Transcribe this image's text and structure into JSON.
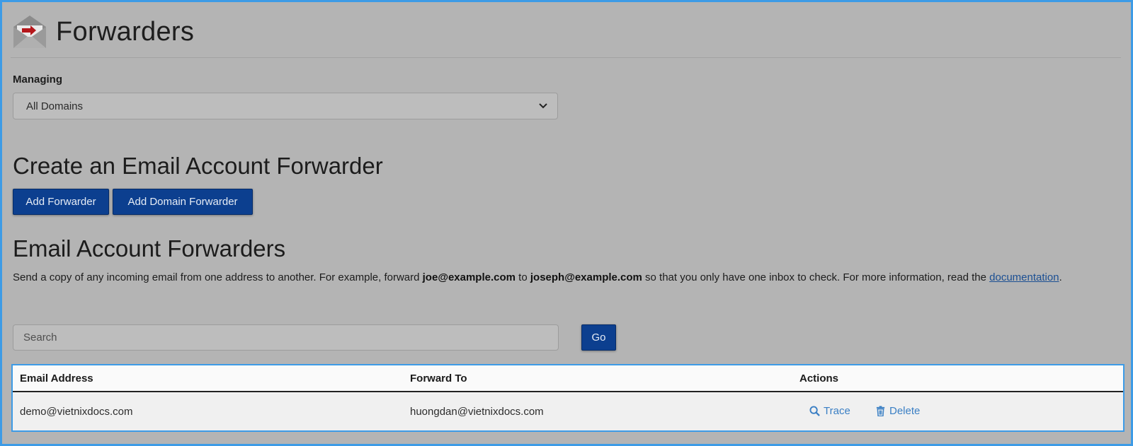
{
  "header": {
    "title": "Forwarders"
  },
  "managing": {
    "label": "Managing",
    "selected": "All Domains"
  },
  "create": {
    "heading": "Create an Email Account Forwarder",
    "add_forwarder": "Add Forwarder",
    "add_domain_forwarder": "Add Domain Forwarder"
  },
  "list": {
    "heading": "Email Account Forwarders",
    "description_1": "Send a copy of any incoming email from one address to another. For example, forward ",
    "example_from": "joe@example.com",
    "description_2": " to ",
    "example_to": "joseph@example.com",
    "description_3": " so that you only have one inbox to check. For more information, read the ",
    "doc_link": "documentation",
    "description_4": "."
  },
  "search": {
    "placeholder": "Search",
    "go_label": "Go"
  },
  "table": {
    "headers": [
      "Email Address",
      "Forward To",
      "Actions"
    ],
    "rows": [
      {
        "email": "demo@vietnixdocs.com",
        "forward_to": "huongdan@vietnixdocs.com",
        "trace": "Trace",
        "delete": "Delete"
      }
    ]
  },
  "colors": {
    "accent": "#0c3f8f",
    "link": "#3a7fc4",
    "frame": "#3d9be6"
  },
  "icons": {
    "header": "envelope-forward-icon",
    "select": "chevron-down-icon",
    "trace": "search-icon",
    "delete": "trash-icon"
  }
}
